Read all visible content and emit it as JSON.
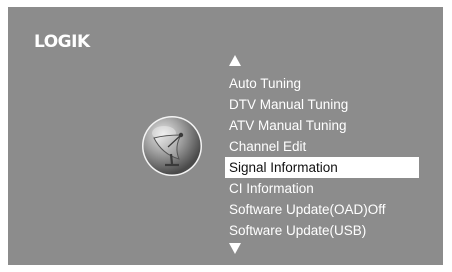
{
  "brand": {
    "logo_text": "LOGIK"
  },
  "navigation": {
    "up_arrow_icon": "triangle-up-icon",
    "down_arrow_icon": "triangle-down-icon"
  },
  "category": {
    "icon": "satellite-dish-icon"
  },
  "menu": {
    "selected_index": 4,
    "items": [
      {
        "label": "Auto Tuning"
      },
      {
        "label": "DTV Manual Tuning"
      },
      {
        "label": "ATV Manual Tuning"
      },
      {
        "label": "Channel Edit"
      },
      {
        "label": "Signal Information"
      },
      {
        "label": "CI Information"
      },
      {
        "label": "Software Update(OAD)Off"
      },
      {
        "label": "Software Update(USB)"
      }
    ]
  },
  "colors": {
    "screen_background": "#8c8c8c",
    "text": "#ffffff",
    "highlight_background": "#ffffff",
    "highlight_text": "#111111"
  }
}
